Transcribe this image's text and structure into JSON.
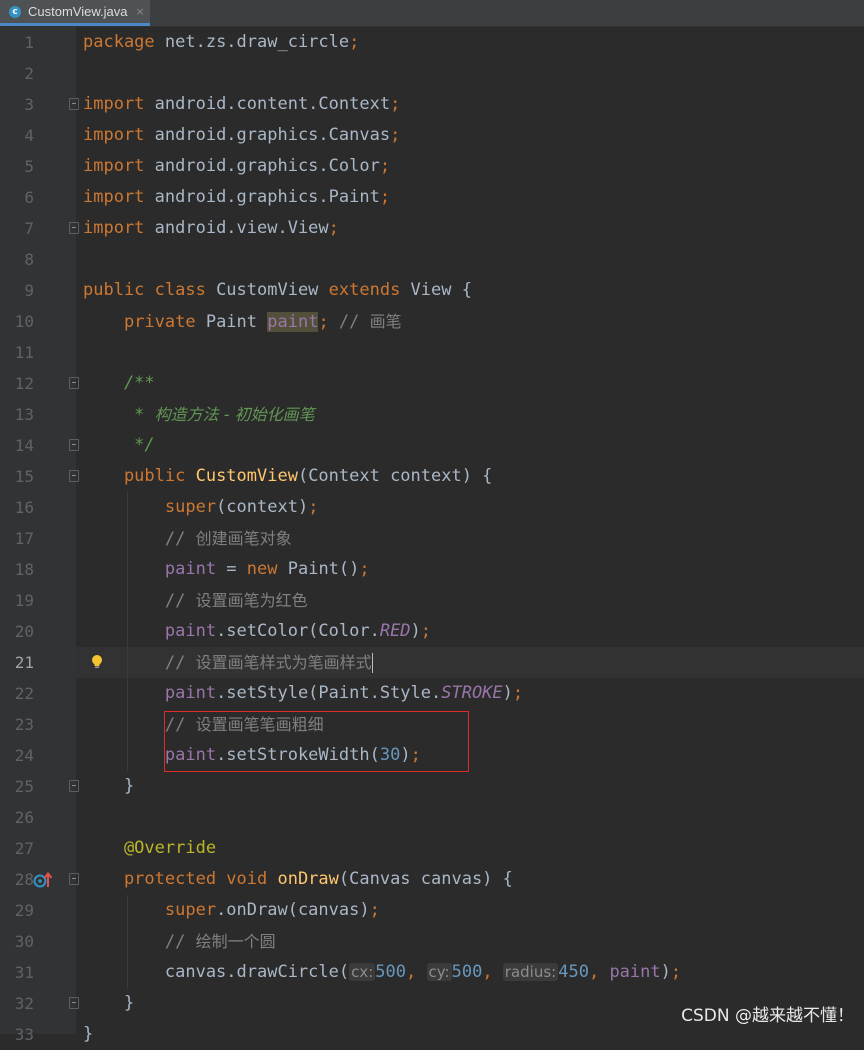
{
  "tab": {
    "title": "CustomView.java",
    "icon_letter": "c",
    "close": "×"
  },
  "lines": [
    [
      {
        "t": "package ",
        "c": "kw"
      },
      {
        "t": "net.zs.draw_circle",
        "c": "pl"
      },
      {
        "t": ";",
        "c": "kw"
      }
    ],
    [],
    [
      {
        "t": "import ",
        "c": "kw"
      },
      {
        "t": "android.content.Context",
        "c": "pl"
      },
      {
        "t": ";",
        "c": "kw"
      }
    ],
    [
      {
        "t": "import ",
        "c": "kw"
      },
      {
        "t": "android.graphics.Canvas",
        "c": "pl"
      },
      {
        "t": ";",
        "c": "kw"
      }
    ],
    [
      {
        "t": "import ",
        "c": "kw"
      },
      {
        "t": "android.graphics.Color",
        "c": "pl"
      },
      {
        "t": ";",
        "c": "kw"
      }
    ],
    [
      {
        "t": "import ",
        "c": "kw"
      },
      {
        "t": "android.graphics.Paint",
        "c": "pl"
      },
      {
        "t": ";",
        "c": "kw"
      }
    ],
    [
      {
        "t": "import ",
        "c": "kw"
      },
      {
        "t": "android.view.View",
        "c": "pl"
      },
      {
        "t": ";",
        "c": "kw"
      }
    ],
    [],
    [
      {
        "t": "public class ",
        "c": "kw"
      },
      {
        "t": "CustomView ",
        "c": "pl"
      },
      {
        "t": "extends ",
        "c": "kw"
      },
      {
        "t": "View {",
        "c": "pl"
      }
    ],
    [
      {
        "t": "    private ",
        "c": "kw"
      },
      {
        "t": "Paint ",
        "c": "pl"
      },
      {
        "t": "paint",
        "c": "fld hl"
      },
      {
        "t": "; ",
        "c": "kw"
      },
      {
        "t": "// ",
        "c": "cm"
      },
      {
        "t": "画笔",
        "c": "cmcn"
      }
    ],
    [],
    [
      {
        "t": "    /**",
        "c": "doc"
      }
    ],
    [
      {
        "t": "     * ",
        "c": "doc"
      },
      {
        "t": "构造方法 - 初始化画笔",
        "c": "doccn"
      }
    ],
    [
      {
        "t": "     */",
        "c": "doc"
      }
    ],
    [
      {
        "t": "    public ",
        "c": "kw"
      },
      {
        "t": "CustomView",
        "c": "fn"
      },
      {
        "t": "(Context context) {",
        "c": "pl"
      }
    ],
    [
      {
        "t": "        super",
        "c": "kw"
      },
      {
        "t": "(context)",
        "c": "pl"
      },
      {
        "t": ";",
        "c": "kw"
      }
    ],
    [
      {
        "t": "        // ",
        "c": "cm"
      },
      {
        "t": "创建画笔对象",
        "c": "cmcn"
      }
    ],
    [
      {
        "t": "        paint",
        "c": "fld"
      },
      {
        "t": " = ",
        "c": "pl"
      },
      {
        "t": "new ",
        "c": "kw"
      },
      {
        "t": "Paint()",
        "c": "pl"
      },
      {
        "t": ";",
        "c": "kw"
      }
    ],
    [
      {
        "t": "        // ",
        "c": "cm"
      },
      {
        "t": "设置画笔为红色",
        "c": "cmcn"
      }
    ],
    [
      {
        "t": "        paint",
        "c": "fld"
      },
      {
        "t": ".setColor(Color.",
        "c": "pl"
      },
      {
        "t": "RED",
        "c": "cst"
      },
      {
        "t": ")",
        "c": "pl"
      },
      {
        "t": ";",
        "c": "kw"
      }
    ],
    [
      {
        "t": "        // ",
        "c": "cm"
      },
      {
        "t": "设置画笔样式为笔画样式",
        "c": "cmcn"
      },
      {
        "t": "",
        "c": "caret"
      }
    ],
    [
      {
        "t": "        paint",
        "c": "fld"
      },
      {
        "t": ".setStyle(Paint.Style.",
        "c": "pl"
      },
      {
        "t": "STROKE",
        "c": "cst"
      },
      {
        "t": ")",
        "c": "pl"
      },
      {
        "t": ";",
        "c": "kw"
      }
    ],
    [
      {
        "t": "        // ",
        "c": "cm"
      },
      {
        "t": "设置画笔笔画粗细",
        "c": "cmcn"
      }
    ],
    [
      {
        "t": "        paint",
        "c": "fld"
      },
      {
        "t": ".setStrokeWidth(",
        "c": "pl"
      },
      {
        "t": "30",
        "c": "num"
      },
      {
        "t": ")",
        "c": "pl"
      },
      {
        "t": ";",
        "c": "kw"
      }
    ],
    [
      {
        "t": "    }",
        "c": "pl"
      }
    ],
    [],
    [
      {
        "t": "    @Override",
        "c": "ann"
      }
    ],
    [
      {
        "t": "    protected void ",
        "c": "kw"
      },
      {
        "t": "onDraw",
        "c": "fn"
      },
      {
        "t": "(Canvas canvas) {",
        "c": "pl"
      }
    ],
    [
      {
        "t": "        super",
        "c": "kw"
      },
      {
        "t": ".onDraw(canvas)",
        "c": "pl"
      },
      {
        "t": ";",
        "c": "kw"
      }
    ],
    [
      {
        "t": "        // ",
        "c": "cm"
      },
      {
        "t": "绘制一个圆",
        "c": "cmcn"
      }
    ],
    [
      {
        "t": "        canvas.drawCircle(",
        "c": "pl"
      },
      {
        "t": "cx:",
        "c": "hint"
      },
      {
        "t": "500",
        "c": "num"
      },
      {
        "t": ", ",
        "c": "kw"
      },
      {
        "t": "cy:",
        "c": "hint"
      },
      {
        "t": "500",
        "c": "num"
      },
      {
        "t": ", ",
        "c": "kw"
      },
      {
        "t": "radius:",
        "c": "hint"
      },
      {
        "t": "450",
        "c": "num"
      },
      {
        "t": ", ",
        "c": "kw"
      },
      {
        "t": "paint",
        "c": "fld"
      },
      {
        "t": ")",
        "c": "pl"
      },
      {
        "t": ";",
        "c": "kw"
      }
    ],
    [
      {
        "t": "    }",
        "c": "pl"
      }
    ],
    [
      {
        "t": "}",
        "c": "pl"
      }
    ]
  ],
  "current_line": 21,
  "watermark": "CSDN @越来越不懂！"
}
